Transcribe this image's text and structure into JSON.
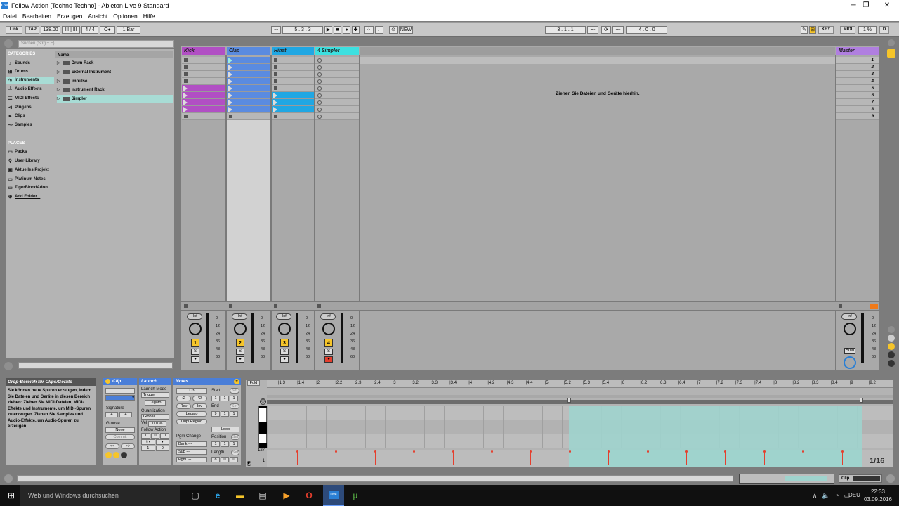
{
  "window": {
    "title": "Follow Action  [Techno Techno] - Ableton Live 9 Standard",
    "app_icon": "Live",
    "minimize": "─",
    "maximize": "❐",
    "close": "✕"
  },
  "menu": [
    "Datei",
    "Bearbeiten",
    "Erzeugen",
    "Ansicht",
    "Optionen",
    "Hilfe"
  ],
  "control_bar": {
    "link": "Link",
    "tap": "TAP",
    "tempo": "138.00",
    "nudge": "III | III",
    "signature": "4 / 4",
    "metro": "O●",
    "quantize": "1 Bar",
    "position": "5 .  3 .  3",
    "new_button": "NEW",
    "loop_start": "3 .  1 .  1",
    "loop_length": "4 .  0 .  0",
    "key": "KEY",
    "midi": "MIDI",
    "cpu": "1 %",
    "d": "D"
  },
  "browser": {
    "search_placeholder": "Suchen (Strg + F)",
    "categories_header": "CATEGORIES",
    "name_header": "Name",
    "categories": [
      {
        "label": "Sounds",
        "icon": "♪"
      },
      {
        "label": "Drums",
        "icon": "⊞"
      },
      {
        "label": "Instruments",
        "icon": "∿"
      },
      {
        "label": "Audio Effects",
        "icon": "╧"
      },
      {
        "label": "MIDI Effects",
        "icon": "☰"
      },
      {
        "label": "Plug-ins",
        "icon": "⊲"
      },
      {
        "label": "Clips",
        "icon": "▸"
      },
      {
        "label": "Samples",
        "icon": "⁓"
      }
    ],
    "places_header": "PLACES",
    "places": [
      "Packs",
      "User-Library",
      "Aktuelles Projekt",
      "Platinum Notes",
      "TigerBloodAdon",
      "Add Folder..."
    ],
    "items": [
      "Drum Rack",
      "External Instrument",
      "Impulse",
      "Instrument Rack",
      "Simpler"
    ]
  },
  "tracks": [
    {
      "name": "Kick",
      "color": "#b14fc4",
      "number": "1"
    },
    {
      "name": "Clap",
      "color": "#5a8be0",
      "number": "2"
    },
    {
      "name": "Hihat",
      "color": "#20a7e3",
      "number": "3"
    },
    {
      "name": "4 Simpler",
      "color": "#3de0e0",
      "number": "4"
    }
  ],
  "master": {
    "name": "Master",
    "scenes": [
      "1",
      "2",
      "3",
      "4",
      "5",
      "6",
      "7",
      "8",
      "9"
    ]
  },
  "drop_hint": "Ziehen Sie Dateien und Geräte hierhin.",
  "mixer": {
    "vol": "-Inf",
    "db": [
      "0",
      "12",
      "24",
      "36",
      "48",
      "60"
    ],
    "solo": "S",
    "rec": "●",
    "solo_master": "Solo"
  },
  "info": {
    "title": "Drop-Bereich für Clips/Geräte",
    "text": "Sie können neue Spuren erzeugen, indem Sie Dateien und Geräte in diesen Bereich ziehen: Ziehen Sie MIDI-Dateien, MIDI-Effekte und Instrumente, um MIDI-Spuren zu erzeugen. Ziehen Sie Samples und Audio-Effekte, um Audio-Spuren zu erzeugen."
  },
  "clip_panel": {
    "title": "Clip",
    "signature": "Signature",
    "sig_num": "4",
    "sig_den": "4",
    "groove": "Groove",
    "groove_value": "None",
    "commit": "Commit",
    "nav_prev": "<<",
    "nav_next": ">>"
  },
  "launch_panel": {
    "title": "Launch",
    "launch_mode": "Launch Mode",
    "mode_value": "Trigger",
    "legato": "Legato",
    "quantization": "Quantization",
    "quant_value": "Global",
    "vel": "Vel",
    "vel_value": "0.0 %",
    "follow_action": "Follow Action",
    "fa1": "1",
    "fa2": "0",
    "fa3": "0",
    "fa4": "1",
    "fa5": "0"
  },
  "notes_panel": {
    "title": "Notes",
    "note": "C3",
    "div2": ":2",
    "mul2": "*2",
    "rev": "Rev",
    "inv": "Inv",
    "legato": "Legato",
    "dupl": "Dupl.Region",
    "pgm_change": "Pgm Change",
    "bank": "Bank ---",
    "sub": "Sub ---",
    "pgm": "Pgm ---",
    "start": "Start",
    "end": "End",
    "loop": "Loop",
    "position": "Position",
    "length": "Length",
    "set": "Set",
    "s1": "1",
    "s2": "1",
    "s3": "1",
    "e1": "9",
    "e2": "1",
    "e3": "1",
    "p1": "1",
    "p2": "1",
    "p3": "1",
    "l1": "8",
    "l2": "0",
    "l3": "0"
  },
  "midi_editor": {
    "fold": "Fold",
    "ruler": [
      "1.3",
      "1.4",
      "2",
      "2.2",
      "2.3",
      "2.4",
      "3",
      "3.2",
      "3.3",
      "3.4",
      "4",
      "4.2",
      "4.3",
      "4.4",
      "5",
      "5.2",
      "5.3",
      "5.4",
      "6",
      "6.2",
      "6.3",
      "6.4",
      "7",
      "7.2",
      "7.3",
      "7.4",
      "8",
      "8.2",
      "8.3",
      "8.4",
      "9",
      "9.2"
    ],
    "vel_max": "127",
    "vel_min": "1",
    "grid": "1/16"
  },
  "status": {
    "clip_label": "Clip"
  },
  "taskbar": {
    "search": "Web und Windows durchsuchen",
    "time": "22:33",
    "date": "03.09.2016",
    "lang": "DEU"
  }
}
